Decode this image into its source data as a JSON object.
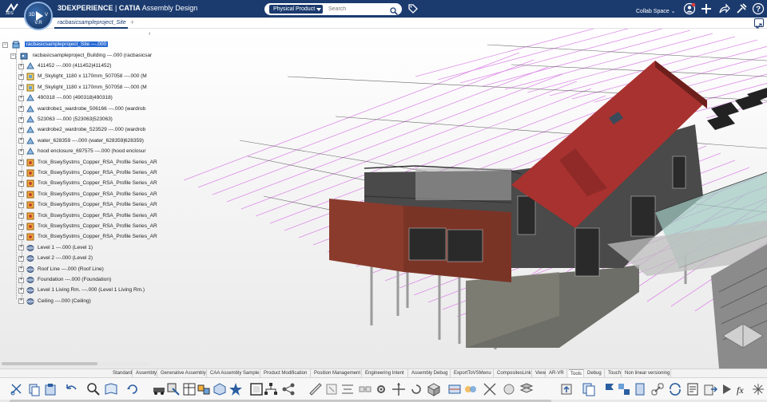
{
  "topbar": {
    "brand": "3DEXPERIENCE",
    "separator": " | ",
    "product": "CATIA",
    "app": "Assembly Design",
    "compass_left": "3D",
    "compass_right": "V",
    "compass_version": "V.R",
    "search_scope": "Physical Product",
    "search_placeholder": "Search",
    "collab_space": "Collab Space",
    "collab_caret": "⌄"
  },
  "tabs": {
    "active": "racbasicsampleproject_Site",
    "add": "+"
  },
  "tree": {
    "collapse": "‹",
    "expander_plus": "+",
    "expander_minus": "−",
    "root": "racbasicsampleproject_Site ---.000",
    "building": "racbasicsampleproject_Building ---.000 (racbasicsar",
    "items": [
      "411452 ---.000 (411452|411452)",
      "M_Skylight_1180 x 1170mm_507058 ---.000 (M",
      "M_Skylight_1180 x 1170mm_507058 ---.000 (M",
      "490318 ---.000 (490318|490318)",
      "wardrobe1_wardrobe_506166 ---.000 (wardrob",
      "523063 ---.000 (523063|523063)",
      "wardrobe2_wardrobe_523529 ---.000 (wardrob",
      "water_628359 ---.000 (water_628359|628359)",
      "hood enclosure_697575 ---.000 (hood enclosur",
      "Trck_BswySystms_Copper_RSA_Profile Series_AR",
      "Trck_BswySystms_Copper_RSA_Profile Series_AR",
      "Trck_BswySystms_Copper_RSA_Profile Series_AR",
      "Trck_BswySystms_Copper_RSA_Profile Series_AR",
      "Trck_BswySystms_Copper_RSA_Profile Series_AR",
      "Trck_BswySystms_Copper_RSA_Profile Series_AR",
      "Trck_BswySystms_Copper_RSA_Profile Series_AR",
      "Trck_BswySystms_Copper_RSA_Profile Series_AR",
      "Level 1 ---.000 (Level 1)",
      "Level 2 ---.000 (Level 2)",
      "Roof Line ---.000 (Roof Line)",
      "Foundation ---.000 (Foundation)",
      "Level 1 Living Rm. ---.000 (Level 1 Living Rm.)",
      "Ceiling ---.000 (Ceiling)"
    ],
    "item_icons": [
      "part-icon",
      "skylight-icon",
      "skylight-icon",
      "part-icon",
      "part-icon",
      "part-icon",
      "part-icon",
      "part-icon",
      "part-icon",
      "track-icon",
      "track-icon",
      "track-icon",
      "track-icon",
      "track-icon",
      "track-icon",
      "track-icon",
      "track-icon",
      "level-icon",
      "level-icon",
      "level-icon",
      "level-icon",
      "level-icon",
      "level-icon"
    ]
  },
  "workbench_tabs": [
    "Standard",
    "Assembly",
    "Generative Assembly",
    "CAA Assembly Sample",
    "Product Modification",
    "Position Management",
    "Engineering Intent",
    "Assembly Debug",
    "ExportToVSMenu",
    "CompositesLink",
    "View",
    "AR-VR",
    "Tools",
    "Debug",
    "Touch",
    "Non linear versioning"
  ],
  "workbench_active": "Tools",
  "actionbar": {
    "formula_label": "fx"
  },
  "colors": {
    "topbar": "#1b3b6f",
    "roof": "#a8322f",
    "wall_dark": "#4a4a4a",
    "cladding": "#8a3b2c",
    "grid_lines": "#d97be6",
    "selection": "#2b6cd4"
  }
}
